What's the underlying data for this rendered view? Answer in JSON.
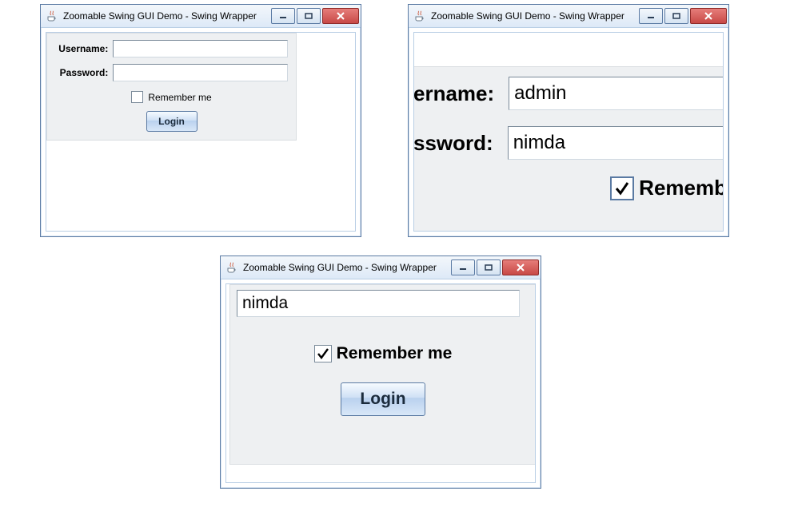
{
  "window_title": "Zoomable Swing GUI Demo - Swing Wrapper",
  "form": {
    "username_label": "Username:",
    "password_label": "Password:",
    "remember_label": "Remember me",
    "login_label": "Login"
  },
  "win1": {
    "username_value": "",
    "password_value": "",
    "remember_checked": false
  },
  "win2": {
    "username_label_clipped": "ername:",
    "password_label_clipped": "ssword:",
    "remember_label_clipped": "Rememb",
    "username_value": "admin",
    "password_value": "nimda",
    "remember_checked": true
  },
  "win3": {
    "password_value": "nimda",
    "remember_checked": true
  }
}
